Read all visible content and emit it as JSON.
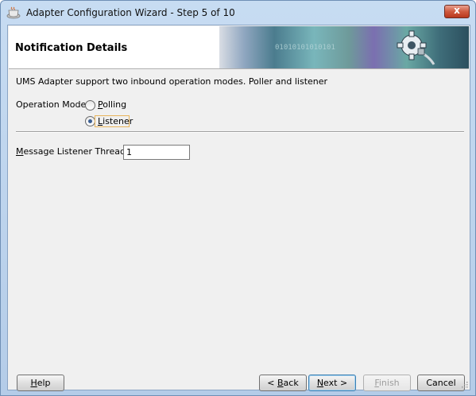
{
  "window": {
    "title": "Adapter Configuration Wizard - Step 5 of 10",
    "close_label": "x"
  },
  "header": {
    "title": "Notification Details",
    "banner_text": "01010101010101"
  },
  "content": {
    "description": "UMS Adapter support two inbound operation modes. Poller and listener",
    "operation_mode_label": "Operation Mode:",
    "modes": [
      {
        "label": "Polling",
        "selected": false
      },
      {
        "label": "Listener",
        "selected": true
      }
    ],
    "threads_label": "Message Listener Threads:",
    "threads_value": "1"
  },
  "buttons": {
    "help": "Help",
    "back": "< Back",
    "next": "Next >",
    "finish": "Finish",
    "cancel": "Cancel"
  },
  "colors": {
    "titlebar": "#b9d1ea",
    "client": "#f0f0f0",
    "close": "#cf5a3f"
  }
}
